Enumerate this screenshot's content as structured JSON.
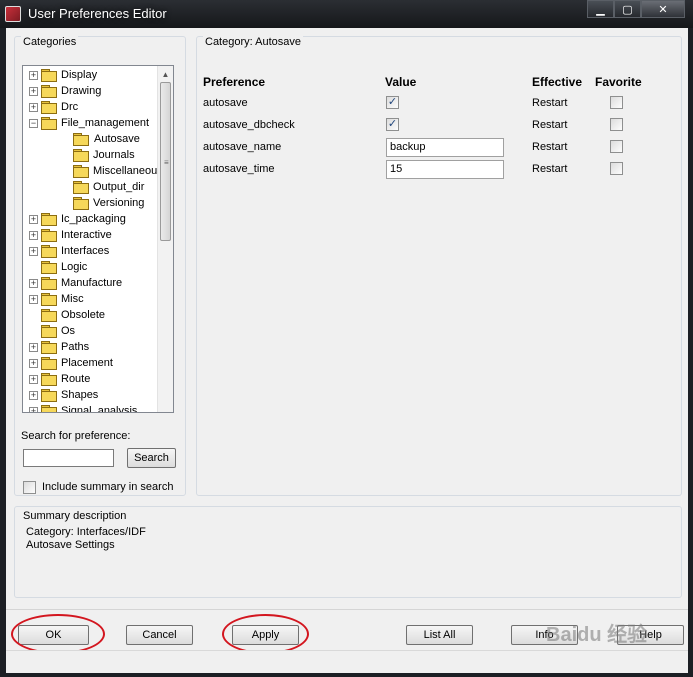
{
  "window": {
    "title": "User Preferences Editor",
    "minimize": "▁",
    "maximize": "▢",
    "close": "✕"
  },
  "categories": {
    "group_label": "Categories",
    "items": [
      {
        "label": "Display",
        "expander": "+"
      },
      {
        "label": "Drawing",
        "expander": "+"
      },
      {
        "label": "Drc",
        "expander": "+"
      },
      {
        "label": "File_management",
        "expander": "−"
      },
      {
        "label": "Autosave",
        "expander": ""
      },
      {
        "label": "Journals",
        "expander": ""
      },
      {
        "label": "Miscellaneous",
        "expander": ""
      },
      {
        "label": "Output_dir",
        "expander": ""
      },
      {
        "label": "Versioning",
        "expander": ""
      },
      {
        "label": "Ic_packaging",
        "expander": "+"
      },
      {
        "label": "Interactive",
        "expander": "+"
      },
      {
        "label": "Interfaces",
        "expander": "+"
      },
      {
        "label": "Logic",
        "expander": ""
      },
      {
        "label": "Manufacture",
        "expander": "+"
      },
      {
        "label": "Misc",
        "expander": "+"
      },
      {
        "label": "Obsolete",
        "expander": ""
      },
      {
        "label": "Os",
        "expander": ""
      },
      {
        "label": "Paths",
        "expander": "+"
      },
      {
        "label": "Placement",
        "expander": "+"
      },
      {
        "label": "Route",
        "expander": "+"
      },
      {
        "label": "Shapes",
        "expander": "+"
      },
      {
        "label": "Signal_analysis",
        "expander": "+"
      }
    ],
    "scroll_up": "▲",
    "scroll_grip": "≡"
  },
  "search": {
    "label": "Search for preference:",
    "value": "",
    "button": "Search",
    "include_summary_label": "Include summary in search",
    "include_summary_checked": false
  },
  "preferences": {
    "category_label": "Category:",
    "category_name": "Autosave",
    "headers": {
      "preference": "Preference",
      "value": "Value",
      "effective": "Effective",
      "favorite": "Favorite"
    },
    "rows": [
      {
        "name": "autosave",
        "type": "checkbox",
        "checked": true,
        "check_glyph": "✓",
        "value": "",
        "effective": "Restart",
        "favorite": false
      },
      {
        "name": "autosave_dbcheck",
        "type": "checkbox",
        "checked": true,
        "check_glyph": "✓",
        "value": "",
        "effective": "Restart",
        "favorite": false
      },
      {
        "name": "autosave_name",
        "type": "text",
        "checked": false,
        "check_glyph": "",
        "value": "backup",
        "effective": "Restart",
        "favorite": false
      },
      {
        "name": "autosave_time",
        "type": "text",
        "checked": false,
        "check_glyph": "",
        "value": "15",
        "effective": "Restart",
        "favorite": false
      }
    ]
  },
  "summary": {
    "group_label": "Summary description",
    "category_line": "Category: Interfaces/IDF",
    "description": "Autosave Settings"
  },
  "buttons": {
    "ok": "OK",
    "cancel": "Cancel",
    "apply": "Apply",
    "list_all": "List All",
    "info": "Info",
    "help": "Help"
  },
  "watermark": "Baidu 经验",
  "highlight_color": "#d3161f"
}
